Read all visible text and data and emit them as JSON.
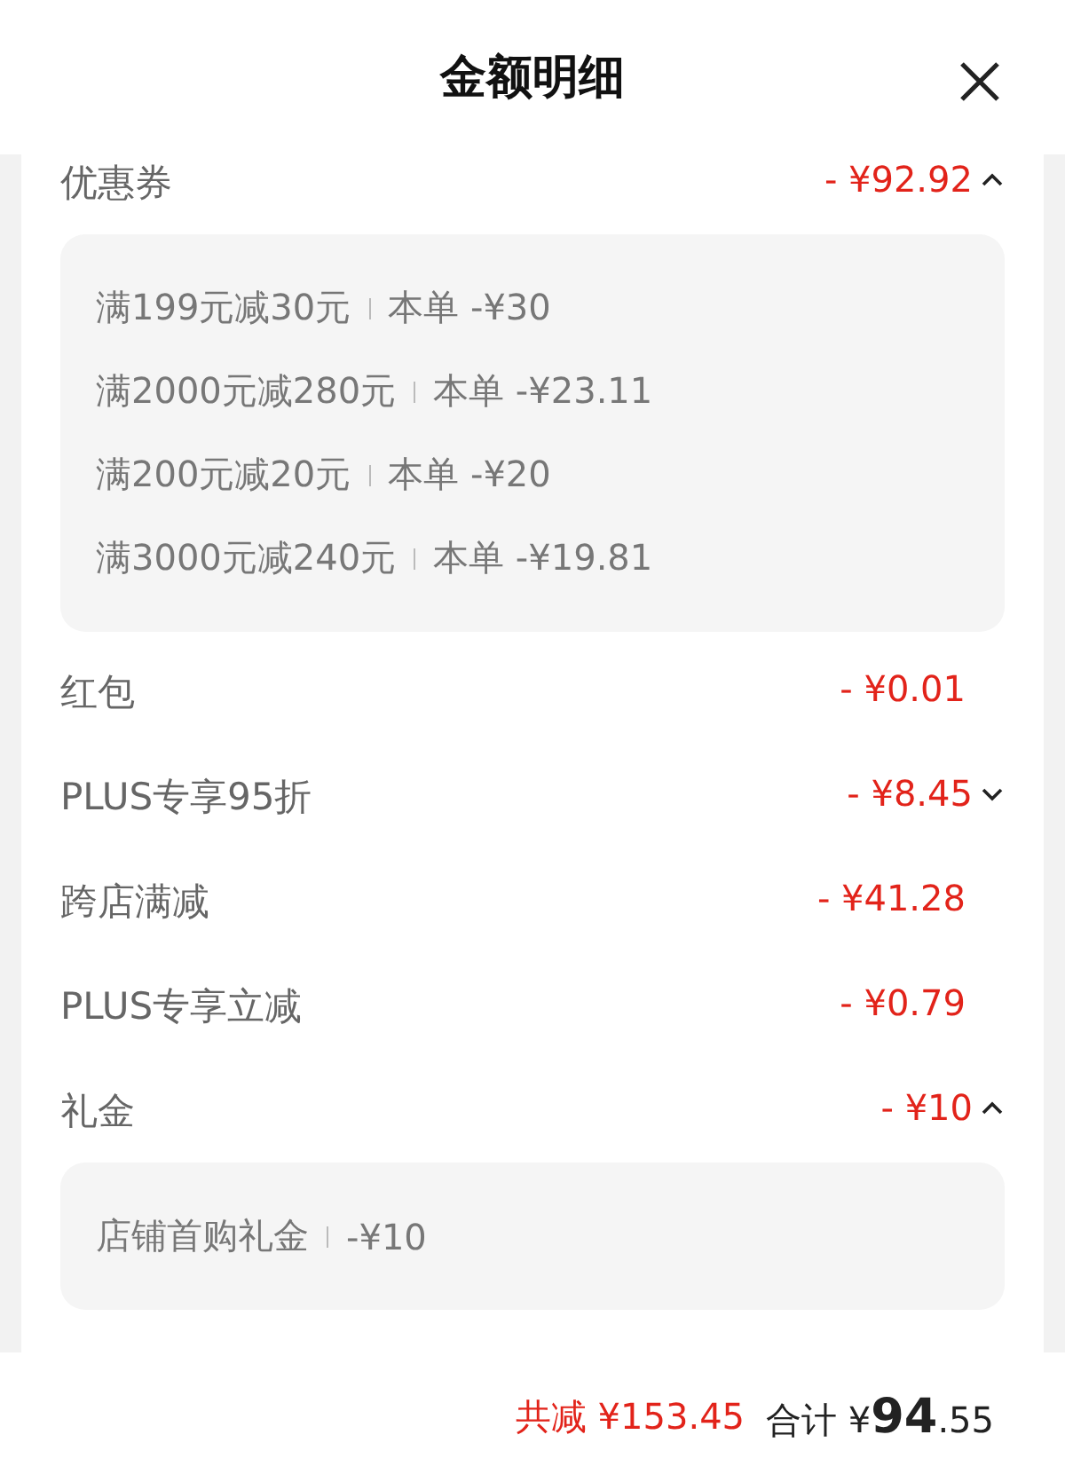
{
  "header": {
    "title": "金额明细"
  },
  "rows": [
    {
      "kind": "collapsible",
      "label": "优惠券",
      "amount": "- ¥92.92",
      "expanded": true,
      "details": [
        {
          "label": "满199元减30元",
          "amount": "本单 -¥30"
        },
        {
          "label": "满2000元减280元",
          "amount": "本单 -¥23.11"
        },
        {
          "label": "满200元减20元",
          "amount": "本单 -¥20"
        },
        {
          "label": "满3000元减240元",
          "amount": "本单 -¥19.81"
        }
      ]
    },
    {
      "kind": "plain",
      "label": "红包",
      "amount": "- ¥0.01"
    },
    {
      "kind": "collapsible",
      "label": "PLUS专享95折",
      "amount": "- ¥8.45",
      "expanded": false,
      "details": []
    },
    {
      "kind": "plain",
      "label": "跨店满减",
      "amount": "- ¥41.28"
    },
    {
      "kind": "plain",
      "label": "PLUS专享立减",
      "amount": "- ¥0.79"
    },
    {
      "kind": "collapsible",
      "label": "礼金",
      "amount": "- ¥10",
      "expanded": true,
      "details": [
        {
          "label": "店铺首购礼金",
          "amount": "-¥10"
        }
      ]
    }
  ],
  "footer": {
    "saved": "共减 ¥153.45",
    "total": {
      "label": "合计 ¥",
      "integer": "94",
      "decimal": ".55"
    }
  }
}
